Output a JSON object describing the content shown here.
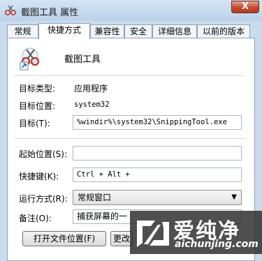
{
  "window": {
    "title": "截图工具 属性",
    "close_label": "X"
  },
  "tabs": [
    {
      "label": "常规"
    },
    {
      "label": "快捷方式"
    },
    {
      "label": "兼容性"
    },
    {
      "label": "安全"
    },
    {
      "label": "详细信息"
    },
    {
      "label": "以前的版本"
    }
  ],
  "app": {
    "name": "截图工具",
    "icon": "scissors-icon"
  },
  "fields": {
    "target_type_label": "目标类型:",
    "target_type_value": "应用程序",
    "target_location_label": "目标位置:",
    "target_location_value": "system32",
    "target_label": "目标(T):",
    "target_value": "%windir%\\system32\\SnippingTool.exe",
    "start_in_label": "起始位置(S):",
    "start_in_value": "",
    "shortcut_key_label": "快捷键(K):",
    "shortcut_key_value": "Ctrl + Alt +",
    "run_label": "运行方式(R):",
    "run_value": "常规窗口",
    "comment_label": "备注(O):",
    "comment_value": "捕获屏幕的一"
  },
  "buttons": {
    "open_file_location": "打开文件位置(F)",
    "change_icon": "更改"
  },
  "watermark": {
    "text": "爱纯净",
    "url": "aichunjing.com"
  }
}
